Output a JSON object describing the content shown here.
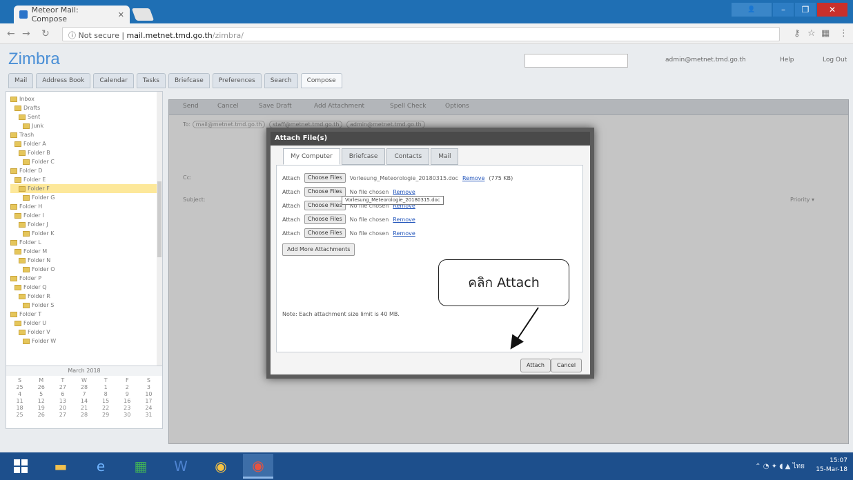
{
  "browser": {
    "tab_title": "Meteor Mail: Compose",
    "url_secure_label": "Not secure",
    "url_host": "mail.metnet.tmd.go.th",
    "url_path": "/zimbra/"
  },
  "zimbra": {
    "logo": "Zimbra",
    "search_placeholder": "",
    "user": "admin@metnet.tmd.go.th",
    "help": "Help",
    "logout": "Log Out",
    "tabs": [
      "Mail",
      "Address Book",
      "Calendar",
      "Tasks",
      "Briefcase",
      "Preferences",
      "Search",
      "Compose"
    ]
  },
  "sidebar": {
    "folders": [
      "Inbox",
      "Drafts",
      "Sent",
      "Junk",
      "Trash",
      "Folder A",
      "Folder B",
      "Folder C",
      "Folder D",
      "Folder E",
      "Folder F",
      "Folder G",
      "Folder H",
      "Folder I",
      "Folder J",
      "Folder K",
      "Folder L",
      "Folder M",
      "Folder N",
      "Folder O",
      "Folder P",
      "Folder Q",
      "Folder R",
      "Folder S",
      "Folder T",
      "Folder U",
      "Folder V",
      "Folder W"
    ]
  },
  "calendar": {
    "title": "March 2018",
    "days": [
      "S",
      "M",
      "T",
      "W",
      "T",
      "F",
      "S",
      "25",
      "26",
      "27",
      "28",
      "1",
      "2",
      "3",
      "4",
      "5",
      "6",
      "7",
      "8",
      "9",
      "10",
      "11",
      "12",
      "13",
      "14",
      "15",
      "16",
      "17",
      "18",
      "19",
      "20",
      "21",
      "22",
      "23",
      "24",
      "25",
      "26",
      "27",
      "28",
      "29",
      "30",
      "31"
    ]
  },
  "compose": {
    "send": "Send",
    "cancel": "Cancel",
    "save_draft": "Save Draft",
    "add_attachment": "Add Attachment",
    "spell_check": "Spell Check",
    "options": "Options",
    "to_label": "To:",
    "cc_label": "Cc:",
    "subject_label": "Subject:",
    "priority_label": "Priority",
    "body_text": "",
    "recipients": [
      "mail@metnet.tmd.go.th",
      "staff@metnet.tmd.go.th",
      "admin@metnet.tmd.go.th"
    ]
  },
  "dialog": {
    "title": "Attach File(s)",
    "tabs": [
      "My Computer",
      "Briefcase",
      "Contacts",
      "Mail"
    ],
    "rows": [
      {
        "label": "Attach",
        "button": "Choose Files",
        "file": "Vorlesung_Meteorologie_20180315.doc",
        "remove": "Remove",
        "size": "(775 KB)"
      },
      {
        "label": "Attach",
        "button": "Choose Files",
        "file": "No file chosen",
        "remove": "Remove",
        "size": ""
      },
      {
        "label": "Attach",
        "button": "Choose Files",
        "file": "No file chosen",
        "remove": "Remove",
        "size": ""
      },
      {
        "label": "Attach",
        "button": "Choose Files",
        "file": "No file chosen",
        "remove": "Remove",
        "size": ""
      },
      {
        "label": "Attach",
        "button": "Choose Files",
        "file": "No file chosen",
        "remove": "Remove",
        "size": ""
      }
    ],
    "tooltip": "Vorlesung_Meteorologie_20180315.doc",
    "add_more": "Add More Attachments",
    "note": "Note: Each attachment size limit is 40 MB.",
    "attach_button": "Attach",
    "cancel_button": "Cancel"
  },
  "callout": {
    "text": "คลิก Attach"
  },
  "taskbar": {
    "clock_time": "15:07",
    "clock_date": "15-Mar-18",
    "tray_lang": "ไทย"
  },
  "colors": {
    "title_bar": "#1f6fb4",
    "taskbar": "#1d4f8c",
    "zimbra_blue": "#4a8fd6",
    "close_red": "#c9302c"
  }
}
